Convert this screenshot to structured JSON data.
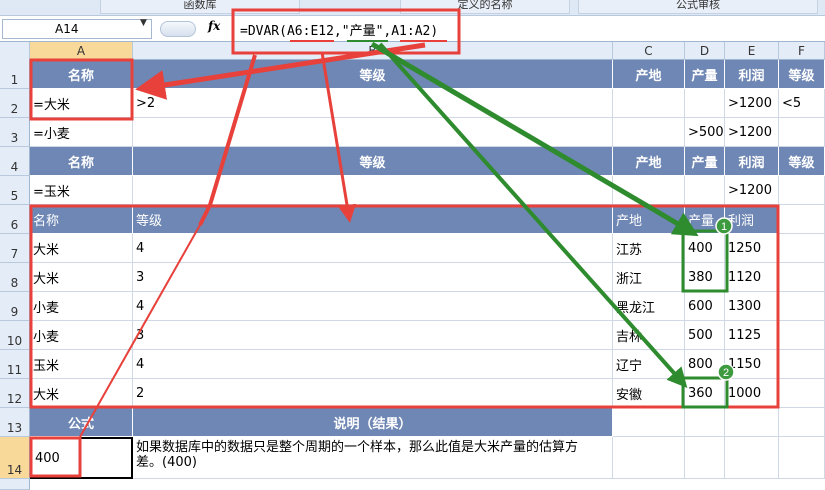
{
  "ribbon": {
    "tabs": [
      "函数库",
      "定义的名称",
      "公式审核"
    ]
  },
  "formula_bar": {
    "name_box": "A14",
    "fx": "fx",
    "formula": "=DVAR(A6:E12,\"产量\",A1:A2)"
  },
  "columns": [
    "A",
    "B",
    "C",
    "D",
    "E",
    "F"
  ],
  "rows": [
    "1",
    "2",
    "3",
    "4",
    "5",
    "6",
    "7",
    "8",
    "9",
    "10",
    "11",
    "12",
    "13",
    "14"
  ],
  "criteria_header": {
    "name": "名称",
    "grade": "等级",
    "origin": "产地",
    "output": "产量",
    "profit": "利润",
    "grade2": "等级"
  },
  "criteria": [
    {
      "name": "=大米",
      "grade": ">2",
      "origin": "",
      "output": "",
      "profit": ">1200",
      "grade2": "<5"
    },
    {
      "name": "=小麦",
      "grade": "",
      "origin": "",
      "output": ">500",
      "profit": ">1200",
      "grade2": ""
    }
  ],
  "criteria2_header": {
    "name": "名称",
    "grade": "等级",
    "origin": "产地",
    "output": "产量",
    "profit": "利润",
    "grade2": "等级"
  },
  "criteria2": {
    "name": "=玉米",
    "profit": ">1200"
  },
  "db_header": {
    "name": "名称",
    "grade": "等级",
    "origin": "产地",
    "output": "产量",
    "profit": "利润"
  },
  "db_rows": [
    {
      "name": "大米",
      "grade": "4",
      "origin": "江苏",
      "output": "400",
      "profit": "1250"
    },
    {
      "name": "大米",
      "grade": "3",
      "origin": "浙江",
      "output": "380",
      "profit": "1120"
    },
    {
      "name": "小麦",
      "grade": "4",
      "origin": "黑龙江",
      "output": "600",
      "profit": "1300"
    },
    {
      "name": "小麦",
      "grade": "3",
      "origin": "吉林",
      "output": "500",
      "profit": "1125"
    },
    {
      "name": "玉米",
      "grade": "4",
      "origin": "辽宁",
      "output": "800",
      "profit": "1150"
    },
    {
      "name": "大米",
      "grade": "2",
      "origin": "安徽",
      "output": "360",
      "profit": "1000"
    }
  ],
  "result_header": {
    "formula": "公式",
    "desc": "说明（结果）"
  },
  "result": {
    "value": "400",
    "desc": "如果数据库中的数据只是整个周期的一个样本，那么此值是大米产量的估算方差。(400)"
  },
  "markers": [
    "1",
    "2"
  ],
  "colors": {
    "header_bg": "#6f87b4",
    "red": "#e8403a",
    "green": "#2e8b2e"
  }
}
